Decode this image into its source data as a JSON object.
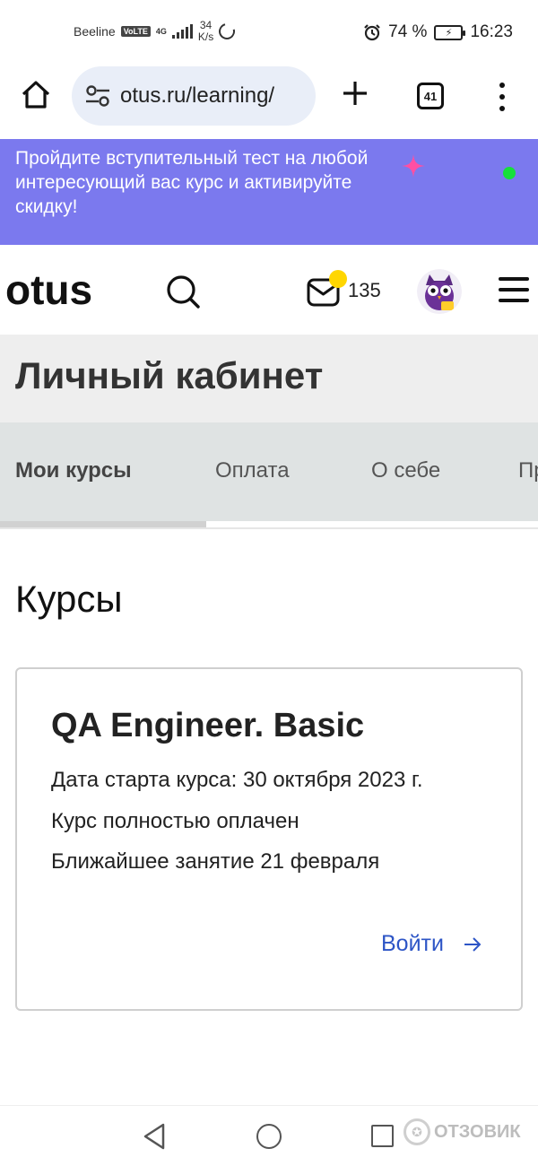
{
  "status_bar": {
    "carrier": "Beeline",
    "volte": "VoLTE",
    "network": "4G",
    "speed_value": "34",
    "speed_unit": "K/s",
    "battery_pct": "74 %",
    "time": "16:23"
  },
  "browser": {
    "url": "otus.ru/learning/",
    "tab_count": "41"
  },
  "promo": {
    "text": "Пройдите вступительный тест на любой интересующий вас курс и активируйте скидку!",
    "accent_color": "#7b79ee"
  },
  "header": {
    "logo_text": "otus",
    "mail_count": "135"
  },
  "cabinet": {
    "title": "Личный кабинет"
  },
  "tabs": [
    {
      "label": "Мои курсы",
      "active": true
    },
    {
      "label": "Оплата",
      "active": false
    },
    {
      "label": "О себе",
      "active": false
    },
    {
      "label": "Пр",
      "active": false
    }
  ],
  "section": {
    "title": "Курсы"
  },
  "course": {
    "title": "QA Engineer. Basic",
    "start_date": "Дата старта курса: 30 октября 2023 г.",
    "payment_status": "Курс полностью оплачен",
    "next_lesson": "Ближайшее занятие 21 февраля",
    "enter_label": "Войти",
    "link_color": "#2d55c6"
  },
  "watermark": {
    "text": "ОТЗОВИК"
  }
}
